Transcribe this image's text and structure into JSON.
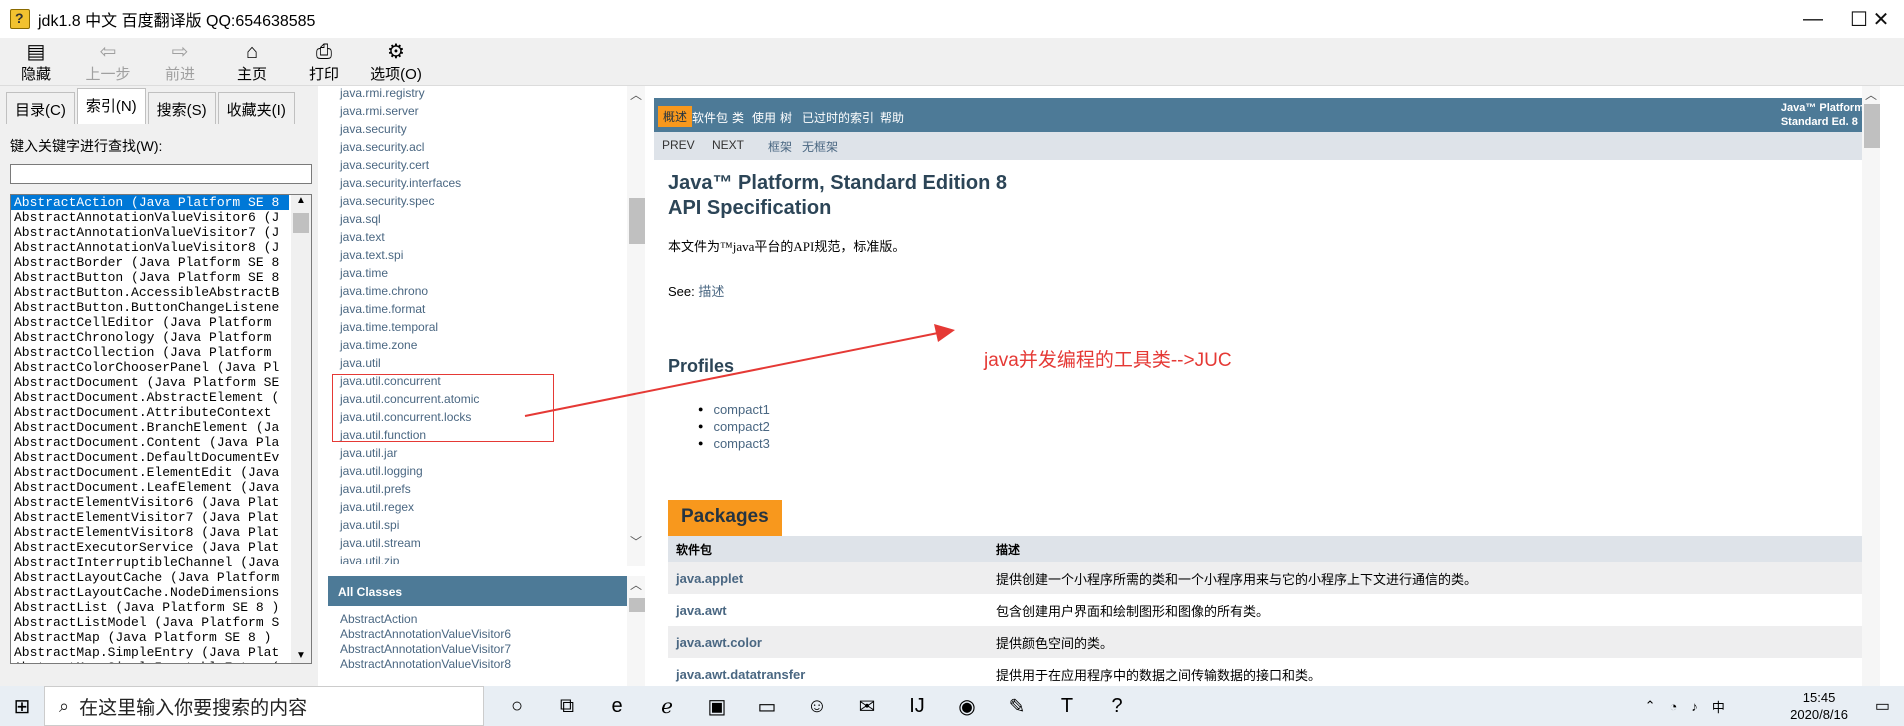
{
  "window": {
    "title": "jdk1.8 中文 百度翻译版 QQ:654638585",
    "minimize": "—",
    "maximize": "☐",
    "close": "✕"
  },
  "toolbar": [
    {
      "icon": "hide-icon",
      "glyph": "▤",
      "label": "隐藏",
      "disabled": false
    },
    {
      "icon": "back-icon",
      "glyph": "⇦",
      "label": "上一步",
      "disabled": true
    },
    {
      "icon": "forward-icon",
      "glyph": "⇨",
      "label": "前进",
      "disabled": true
    },
    {
      "icon": "home-icon",
      "glyph": "⌂",
      "label": "主页",
      "disabled": false
    },
    {
      "icon": "print-icon",
      "glyph": "⎙",
      "label": "打印",
      "disabled": false
    },
    {
      "icon": "options-icon",
      "glyph": "⚙",
      "label": "选项(O)",
      "disabled": false
    }
  ],
  "tabs": [
    {
      "label": "目录(C)"
    },
    {
      "label": "索引(N)",
      "active": true
    },
    {
      "label": "搜索(S)"
    },
    {
      "label": "收藏夹(I)"
    }
  ],
  "search": {
    "label": "键入关键字进行查找(W):",
    "value": ""
  },
  "index_items": [
    "AbstractAction (Java Platform SE 8",
    "AbstractAnnotationValueVisitor6 (J",
    "AbstractAnnotationValueVisitor7 (J",
    "AbstractAnnotationValueVisitor8 (J",
    "AbstractBorder (Java Platform SE 8",
    "AbstractButton (Java Platform SE 8",
    "AbstractButton.AccessibleAbstractB",
    "AbstractButton.ButtonChangeListene",
    "AbstractCellEditor (Java Platform ",
    "AbstractChronology (Java Platform ",
    "AbstractCollection (Java Platform ",
    "AbstractColorChooserPanel (Java Pl",
    "AbstractDocument (Java Platform SE",
    "AbstractDocument.AbstractElement (",
    "AbstractDocument.AttributeContext ",
    "AbstractDocument.BranchElement (Ja",
    "AbstractDocument.Content (Java Pla",
    "AbstractDocument.DefaultDocumentEv",
    "AbstractDocument.ElementEdit (Java",
    "AbstractDocument.LeafElement (Java",
    "AbstractElementVisitor6 (Java Plat",
    "AbstractElementVisitor7 (Java Plat",
    "AbstractElementVisitor8 (Java Plat",
    "AbstractExecutorService (Java Plat",
    "AbstractInterruptibleChannel (Java",
    "AbstractLayoutCache (Java Platform",
    "AbstractLayoutCache.NodeDimensions",
    "AbstractList (Java Platform SE 8 )",
    "AbstractListModel (Java Platform S",
    "AbstractMap (Java Platform SE 8 )",
    "AbstractMap.SimpleEntry (Java Plat",
    "AbstractMap.SimpleImmutableEntry ("
  ],
  "packages_frame": [
    "java.rmi.registry",
    "java.rmi.server",
    "java.security",
    "java.security.acl",
    "java.security.cert",
    "java.security.interfaces",
    "java.security.spec",
    "java.sql",
    "java.text",
    "java.text.spi",
    "java.time",
    "java.time.chrono",
    "java.time.format",
    "java.time.temporal",
    "java.time.zone",
    "java.util",
    "java.util.concurrent",
    "java.util.concurrent.atomic",
    "java.util.concurrent.locks",
    "java.util.function",
    "java.util.jar",
    "java.util.logging",
    "java.util.prefs",
    "java.util.regex",
    "java.util.spi",
    "java.util.stream",
    "java.util.zip"
  ],
  "all_classes": {
    "title": "All Classes",
    "items": [
      "AbstractAction",
      "AbstractAnnotationValueVisitor6",
      "AbstractAnnotationValueVisitor7",
      "AbstractAnnotationValueVisitor8"
    ]
  },
  "top_nav": [
    {
      "label": "概述",
      "active": true
    },
    {
      "label": "软件包"
    },
    {
      "label": "类"
    },
    {
      "label": "使用"
    },
    {
      "label": "树"
    },
    {
      "label": "已过时的"
    },
    {
      "label": "索引"
    },
    {
      "label": "帮助"
    }
  ],
  "platform_label": [
    "Java™ Platform",
    "Standard Ed. 8"
  ],
  "sub_nav": {
    "prev": "PREV",
    "next": "NEXT",
    "frames": "框架",
    "no_frames": "无框架"
  },
  "doc": {
    "title_line1": "Java™ Platform, Standard Edition 8",
    "title_line2": "API Specification",
    "description": "本文件为™java平台的API规范，标准版。",
    "see_label": "See:",
    "see_link": "描述",
    "profiles_title": "Profiles",
    "profiles": [
      "compact1",
      "compact2",
      "compact3"
    ],
    "packages_caption": "Packages",
    "table_headers": [
      "软件包",
      "描述"
    ],
    "packages": [
      {
        "name": "java.applet",
        "desc": "提供创建一个小程序所需的类和一个小程序用来与它的小程序上下文进行通信的类。"
      },
      {
        "name": "java.awt",
        "desc": "包含创建用户界面和绘制图形和图像的所有类。"
      },
      {
        "name": "java.awt.color",
        "desc": "提供颜色空间的类。"
      },
      {
        "name": "java.awt.datatransfer",
        "desc": "提供用于在应用程序中的数据之间传输数据的接口和类。"
      }
    ]
  },
  "annotation": "java并发编程的工具类-->JUC",
  "taskbar": {
    "search_placeholder": "在这里输入你要搜索的内容",
    "time": "15:45",
    "date": "2020/8/16",
    "apps": [
      "cortana-icon",
      "task-view-icon",
      "edge-icon",
      "ie-icon",
      "office-icon",
      "file-explorer-icon",
      "avatar-app-icon",
      "wechat-icon",
      "intellij-icon",
      "chrome-icon",
      "evernote-icon",
      "typora-icon",
      "jdk-help-icon"
    ]
  }
}
